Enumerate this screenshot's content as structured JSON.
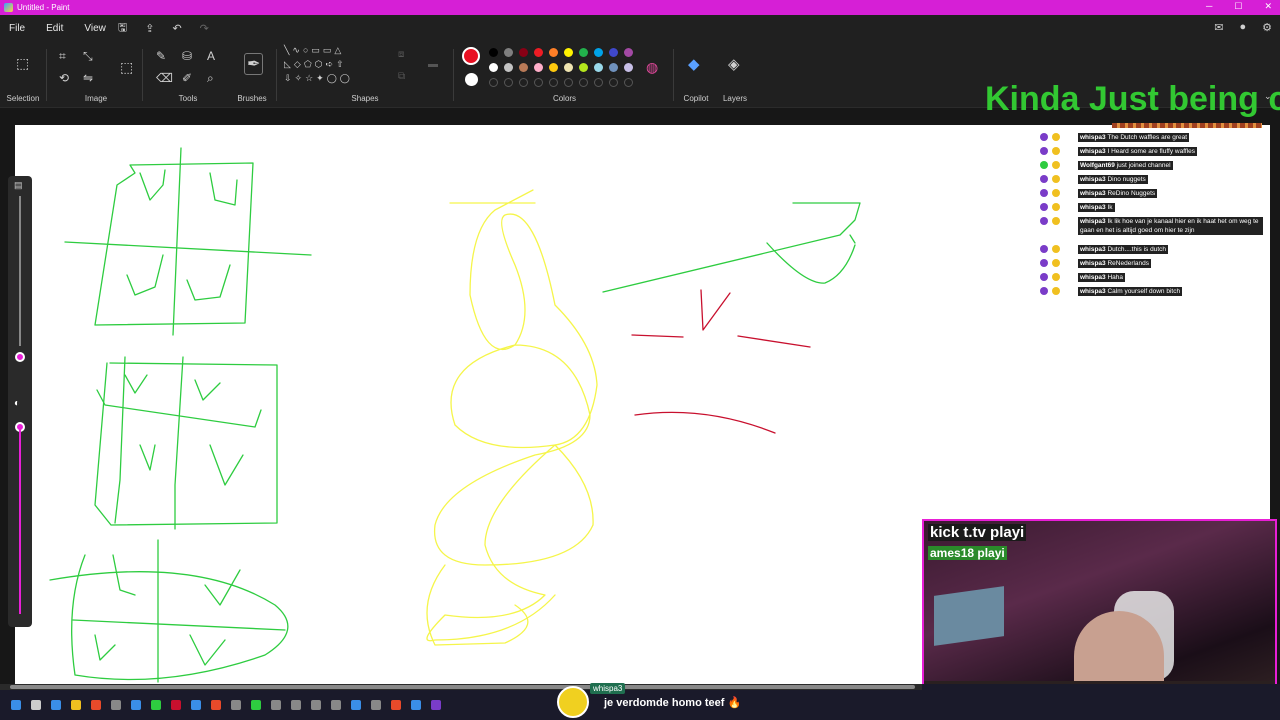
{
  "window": {
    "title": "Untitled - Paint",
    "minimize": "─",
    "maximize": "☐",
    "close": "✕"
  },
  "menu": {
    "file": "File",
    "edit": "Edit",
    "view": "View"
  },
  "ribbon": {
    "groups": {
      "selection": "Selection",
      "image": "Image",
      "tools": "Tools",
      "brushes": "Brushes",
      "shapes": "Shapes",
      "colors": "Colors",
      "copilot": "Copilot",
      "layers": "Layers"
    },
    "primary_color": "#e81123",
    "secondary_color": "#ffffff",
    "palette_row1": [
      "#000000",
      "#7f7f7f",
      "#880015",
      "#ed1c24",
      "#ff7f27",
      "#fff200",
      "#22b14c",
      "#00a2e8",
      "#3f48cc",
      "#a349a4"
    ],
    "palette_row2": [
      "#ffffff",
      "#c3c3c3",
      "#b97a57",
      "#ffaec9",
      "#ffc90e",
      "#efe4b0",
      "#b5e61d",
      "#99d9ea",
      "#7092be",
      "#c8bfe7"
    ]
  },
  "overlay": {
    "title": "Kinda Just being c",
    "chat": [
      {
        "user": "whispa3",
        "text": "The Dutch waffles are great"
      },
      {
        "user": "whispa3",
        "text": "I Heard some are fluffy waffles"
      },
      {
        "user": "Wolfgant69",
        "text": "just joined channel"
      },
      {
        "user": "whispa3",
        "text": "Dino nuggets"
      },
      {
        "user": "whispa3",
        "text": "ReDino Nuggets"
      },
      {
        "user": "whispa3",
        "text": "Ik"
      },
      {
        "user": "whispa3",
        "text": "Ik lik hoe van je kanaal hier en ik haat het om weg te gaan en het is altijd goed om hier te zijn"
      },
      {
        "user": "whispa3",
        "text": "Dutch....this is dutch"
      },
      {
        "user": "whispa3",
        "text": "ReNederlands"
      },
      {
        "user": "whispa3",
        "text": "Haha"
      },
      {
        "user": "whispa3",
        "text": "Calm yourself down bitch"
      }
    ],
    "webcam_label1": "kick t.tv playi",
    "webcam_label2": "ames18 playi"
  },
  "alert": {
    "name": "whispa3",
    "message": "je verdomde homo teef 🔥"
  }
}
